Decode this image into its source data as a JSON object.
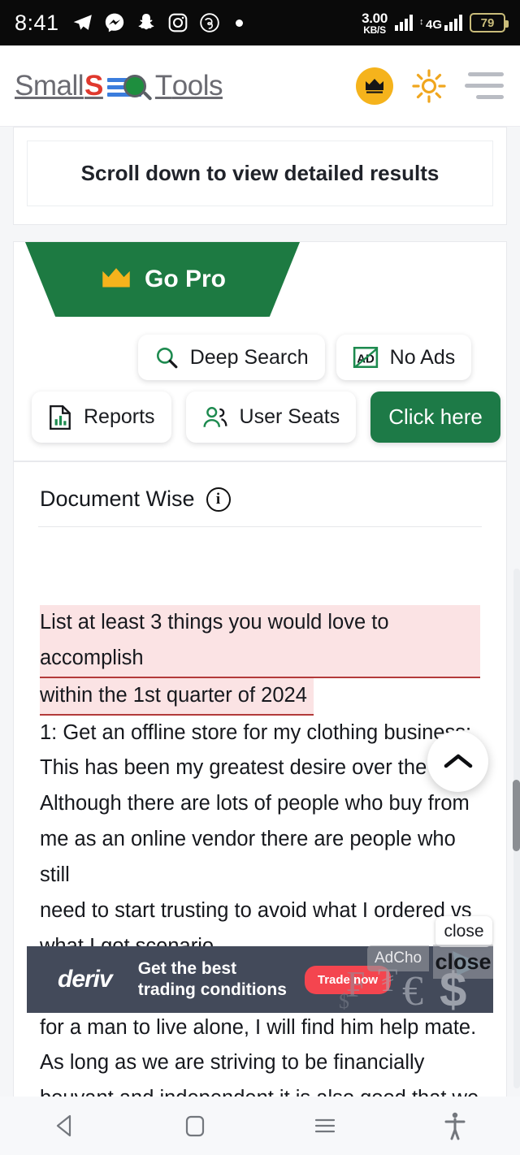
{
  "status_bar": {
    "time": "8:41",
    "app_icons": [
      "telegram-icon",
      "messenger-icon",
      "snapchat-icon",
      "instagram-icon",
      "threads-icon",
      "dot-icon"
    ],
    "network_speed_value": "3.00",
    "network_speed_unit": "KB/S",
    "network_type": "4G",
    "battery_level": "79"
  },
  "header": {
    "logo": {
      "part1": "Small",
      "part2": "S",
      "part3": "T",
      "part4": "ools"
    },
    "crown_badge": "crown-icon",
    "theme_toggle": "sun-icon",
    "menu": "hamburger-menu-icon"
  },
  "results_notice": {
    "text": "Scroll down to view detailed results"
  },
  "pro_panel": {
    "ribbon_label": "Go Pro",
    "features": [
      {
        "label": "Deep Search",
        "icon": "search-icon"
      },
      {
        "label": "No Ads",
        "icon": "no-ads-icon"
      },
      {
        "label": "Reports",
        "icon": "report-document-icon"
      },
      {
        "label": "User Seats",
        "icon": "users-icon"
      }
    ],
    "cta_label": "Click here",
    "accent_green": "#1d7a42",
    "accent_gold": "#f5b31c"
  },
  "document_wise": {
    "title": "Document Wise",
    "info_icon": "info-icon",
    "highlighted_lines": [
      "List at least 3 things you would love to accomplish",
      "within the 1st quarter of 2024"
    ],
    "body_lines": [
      "1: Get an offline store for my clothing business:",
      "This has been my greatest desire over the ye",
      "Although there are lots of people who buy from",
      "me as an online vendor there are people who still",
      "need to start trusting to avoid what I ordered vs",
      "what I got scenario."
    ],
    "body_lines_after_ad": [
      "for a man to live alone, I will find him help mate.",
      "As long as we are striving to be financially",
      "bouyant and independent.it is also good that we"
    ],
    "highlight_bg": "#fbe3e4",
    "highlight_underline": "#b33a3a",
    "scroll_top_icon": "chevron-up-icon"
  },
  "advertisement": {
    "brand": "deriv",
    "headline_line1": "Get the best",
    "headline_line2": "trading conditions",
    "cta_label": "Trade now",
    "adchoices_label": "AdCho",
    "close_label": "close",
    "close_label_overlay": "close",
    "cta_color": "#f4454f",
    "background": "#434a5a"
  },
  "system_nav": {
    "back": "back-triangle-icon",
    "home": "home-square-icon",
    "recents": "recents-lines-icon",
    "accessibility": "accessibility-person-icon"
  }
}
